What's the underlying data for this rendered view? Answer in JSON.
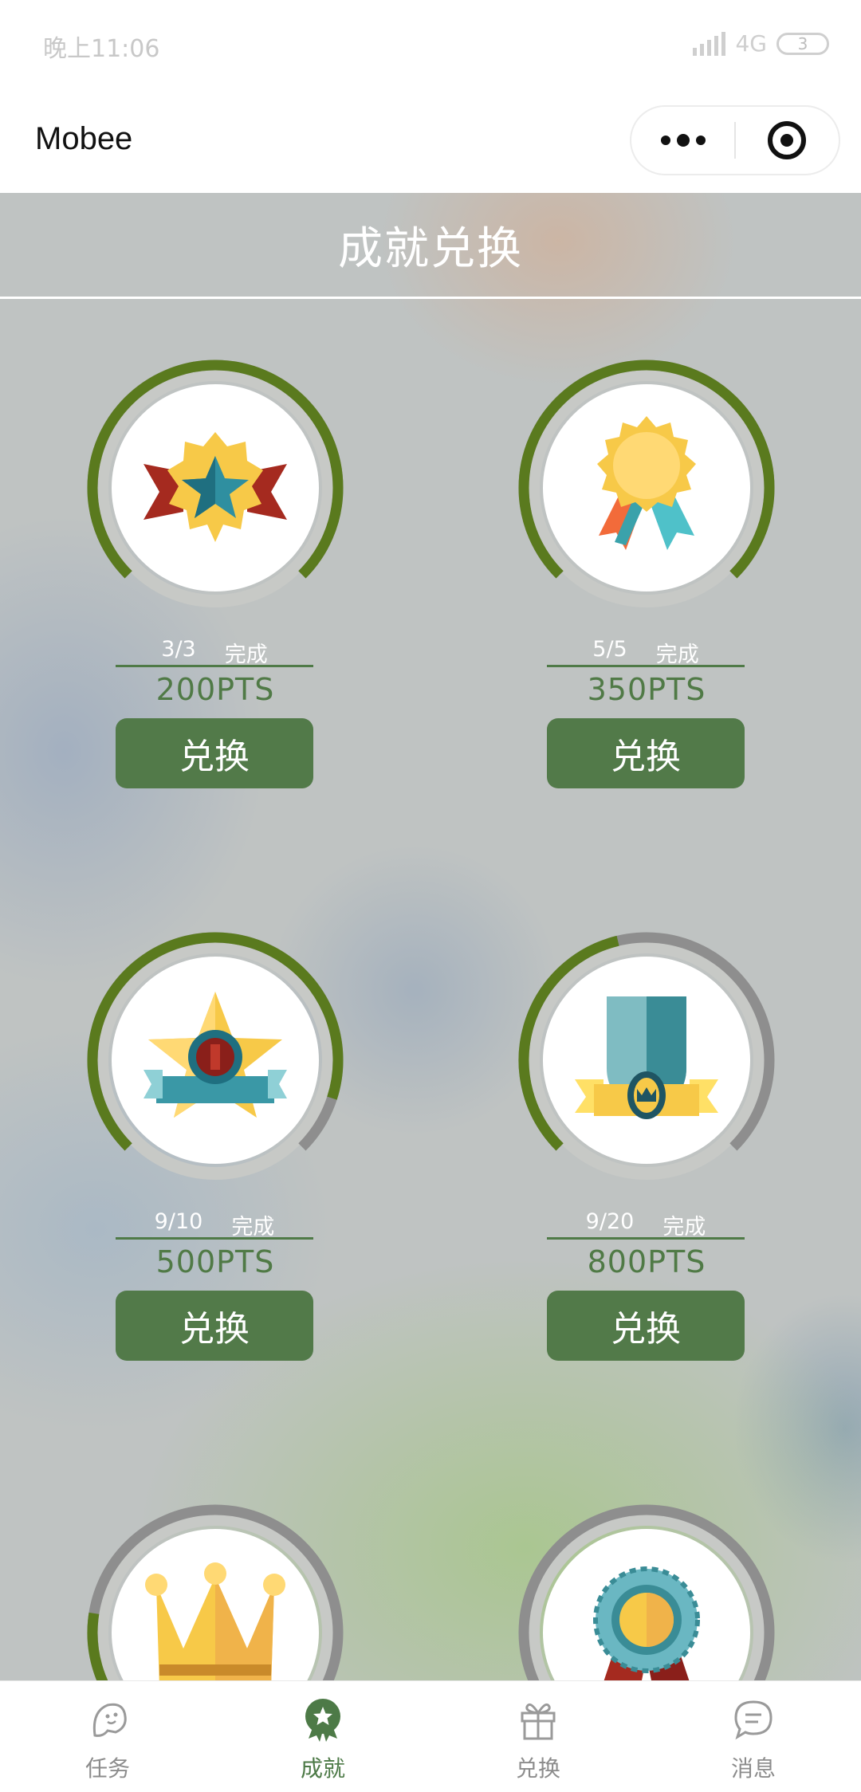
{
  "status_bar": {
    "time": "晚上11:06",
    "network": "4G",
    "battery": "3"
  },
  "nav": {
    "title": "Mobee"
  },
  "header": {
    "title": "成就兑换"
  },
  "achievements": [
    {
      "progress": "3/3",
      "status": "完成",
      "points": "200PTS",
      "button": "兑换",
      "fraction": 1.0,
      "badge": "ribbon-star-badge-icon"
    },
    {
      "progress": "5/5",
      "status": "完成",
      "points": "350PTS",
      "button": "兑换",
      "fraction": 1.0,
      "badge": "rosette-medal-icon"
    },
    {
      "progress": "9/10",
      "status": "完成",
      "points": "500PTS",
      "button": "兑换",
      "fraction": 0.9,
      "badge": "star-banner-badge-icon"
    },
    {
      "progress": "9/20",
      "status": "完成",
      "points": "800PTS",
      "button": "兑换",
      "fraction": 0.45,
      "badge": "shield-crown-badge-icon"
    },
    {
      "fraction": 0.2,
      "badge": "crown-icon"
    },
    {
      "fraction": 0.05,
      "badge": "round-rosette-medal-icon"
    }
  ],
  "tabs": [
    {
      "label": "任务",
      "icon": "task-ghost-icon",
      "active": false
    },
    {
      "label": "成就",
      "icon": "achievement-star-icon",
      "active": true
    },
    {
      "label": "兑换",
      "icon": "gift-icon",
      "active": false
    },
    {
      "label": "消息",
      "icon": "message-bubble-icon",
      "active": false
    }
  ],
  "colors": {
    "ring_progress": "#5a7a1e",
    "ring_track": "#8e8e8e",
    "button": "#527a49",
    "points_text": "#507a46",
    "active_tab": "#4d7a47"
  }
}
